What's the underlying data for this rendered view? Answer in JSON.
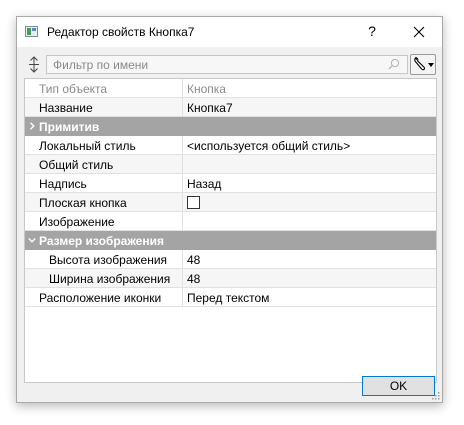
{
  "window": {
    "title": "Редактор свойств Кнопка7",
    "help_label": "?",
    "icon": "app-window-icon",
    "close_icon": "close-icon"
  },
  "filter": {
    "placeholder": "Фильтр по имени",
    "value": "",
    "expand_icon": "expand-vertical-icon",
    "search_icon": "search-icon",
    "tool_icon": "wrench-icon"
  },
  "properties": {
    "type_row": {
      "name": "Тип объекта",
      "value": "Кнопка"
    },
    "name_row": {
      "name": "Название",
      "value": "Кнопка7"
    },
    "cat_primitive": {
      "name": "Примитив",
      "expanded": false
    },
    "local_style": {
      "name": "Локальный стиль",
      "value": "<используется общий стиль>"
    },
    "common_style": {
      "name": "Общий стиль",
      "value": ""
    },
    "caption": {
      "name": "Надпись",
      "value": "Назад"
    },
    "flat_button": {
      "name": "Плоская кнопка",
      "checked": false
    },
    "image": {
      "name": "Изображение",
      "value": ""
    },
    "cat_image_size": {
      "name": "Размер изображения",
      "expanded": true
    },
    "image_height": {
      "name": "Высота изображения",
      "value": "48"
    },
    "image_width": {
      "name": "Ширина изображения",
      "value": "48"
    },
    "icon_position": {
      "name": "Расположение иконки",
      "value": "Перед текстом"
    }
  },
  "buttons": {
    "ok": "OK"
  },
  "colors": {
    "category_bg": "#a4a4a4",
    "category_text": "#ffffff",
    "accent": "#0078d7"
  }
}
